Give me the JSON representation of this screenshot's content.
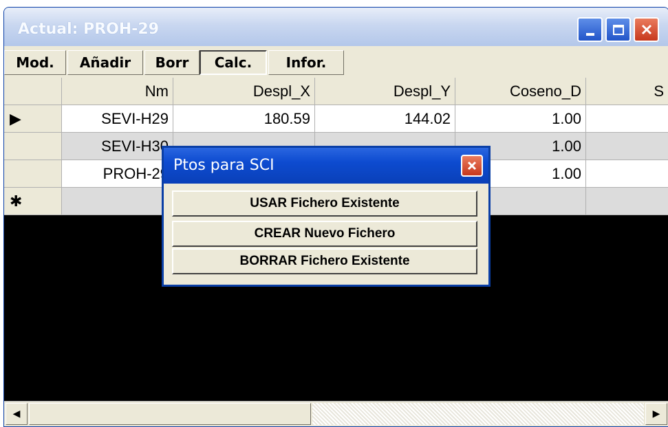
{
  "window": {
    "title": "Actual: PROH-29"
  },
  "toolbar": {
    "mod": "Mod.",
    "anadir": "Añadir",
    "borr": "Borr",
    "calc": "Calc.",
    "infor": "Infor."
  },
  "grid": {
    "columns": [
      "Nm",
      "Despl_X",
      "Despl_Y",
      "Coseno_D",
      "S"
    ],
    "rows": [
      {
        "indicator": "▶",
        "nm": "SEVI-H29",
        "x": "180.59",
        "y": "144.02",
        "cos": "1.00"
      },
      {
        "indicator": "",
        "nm": "SEVI-H30",
        "x": "",
        "y": "",
        "cos": "1.00"
      },
      {
        "indicator": "",
        "nm": "PROH-29",
        "x": "",
        "y": "",
        "cos": "1.00"
      }
    ],
    "new_row_indicator": "✱"
  },
  "dialog": {
    "title": "Ptos para SCI",
    "buttons": [
      "USAR Fichero Existente",
      "CREAR Nuevo Fichero",
      "BORRAR Fichero Existente"
    ]
  },
  "scrollbar": {
    "left": "◀",
    "right": "▶"
  },
  "icons": {
    "close": "close-icon",
    "minimize": "minimize-icon",
    "maximize": "maximize-icon"
  },
  "colors": {
    "titlebar": "#c9d7f0",
    "dialog_title": "#0d4bd0",
    "close": "#c7381d"
  }
}
